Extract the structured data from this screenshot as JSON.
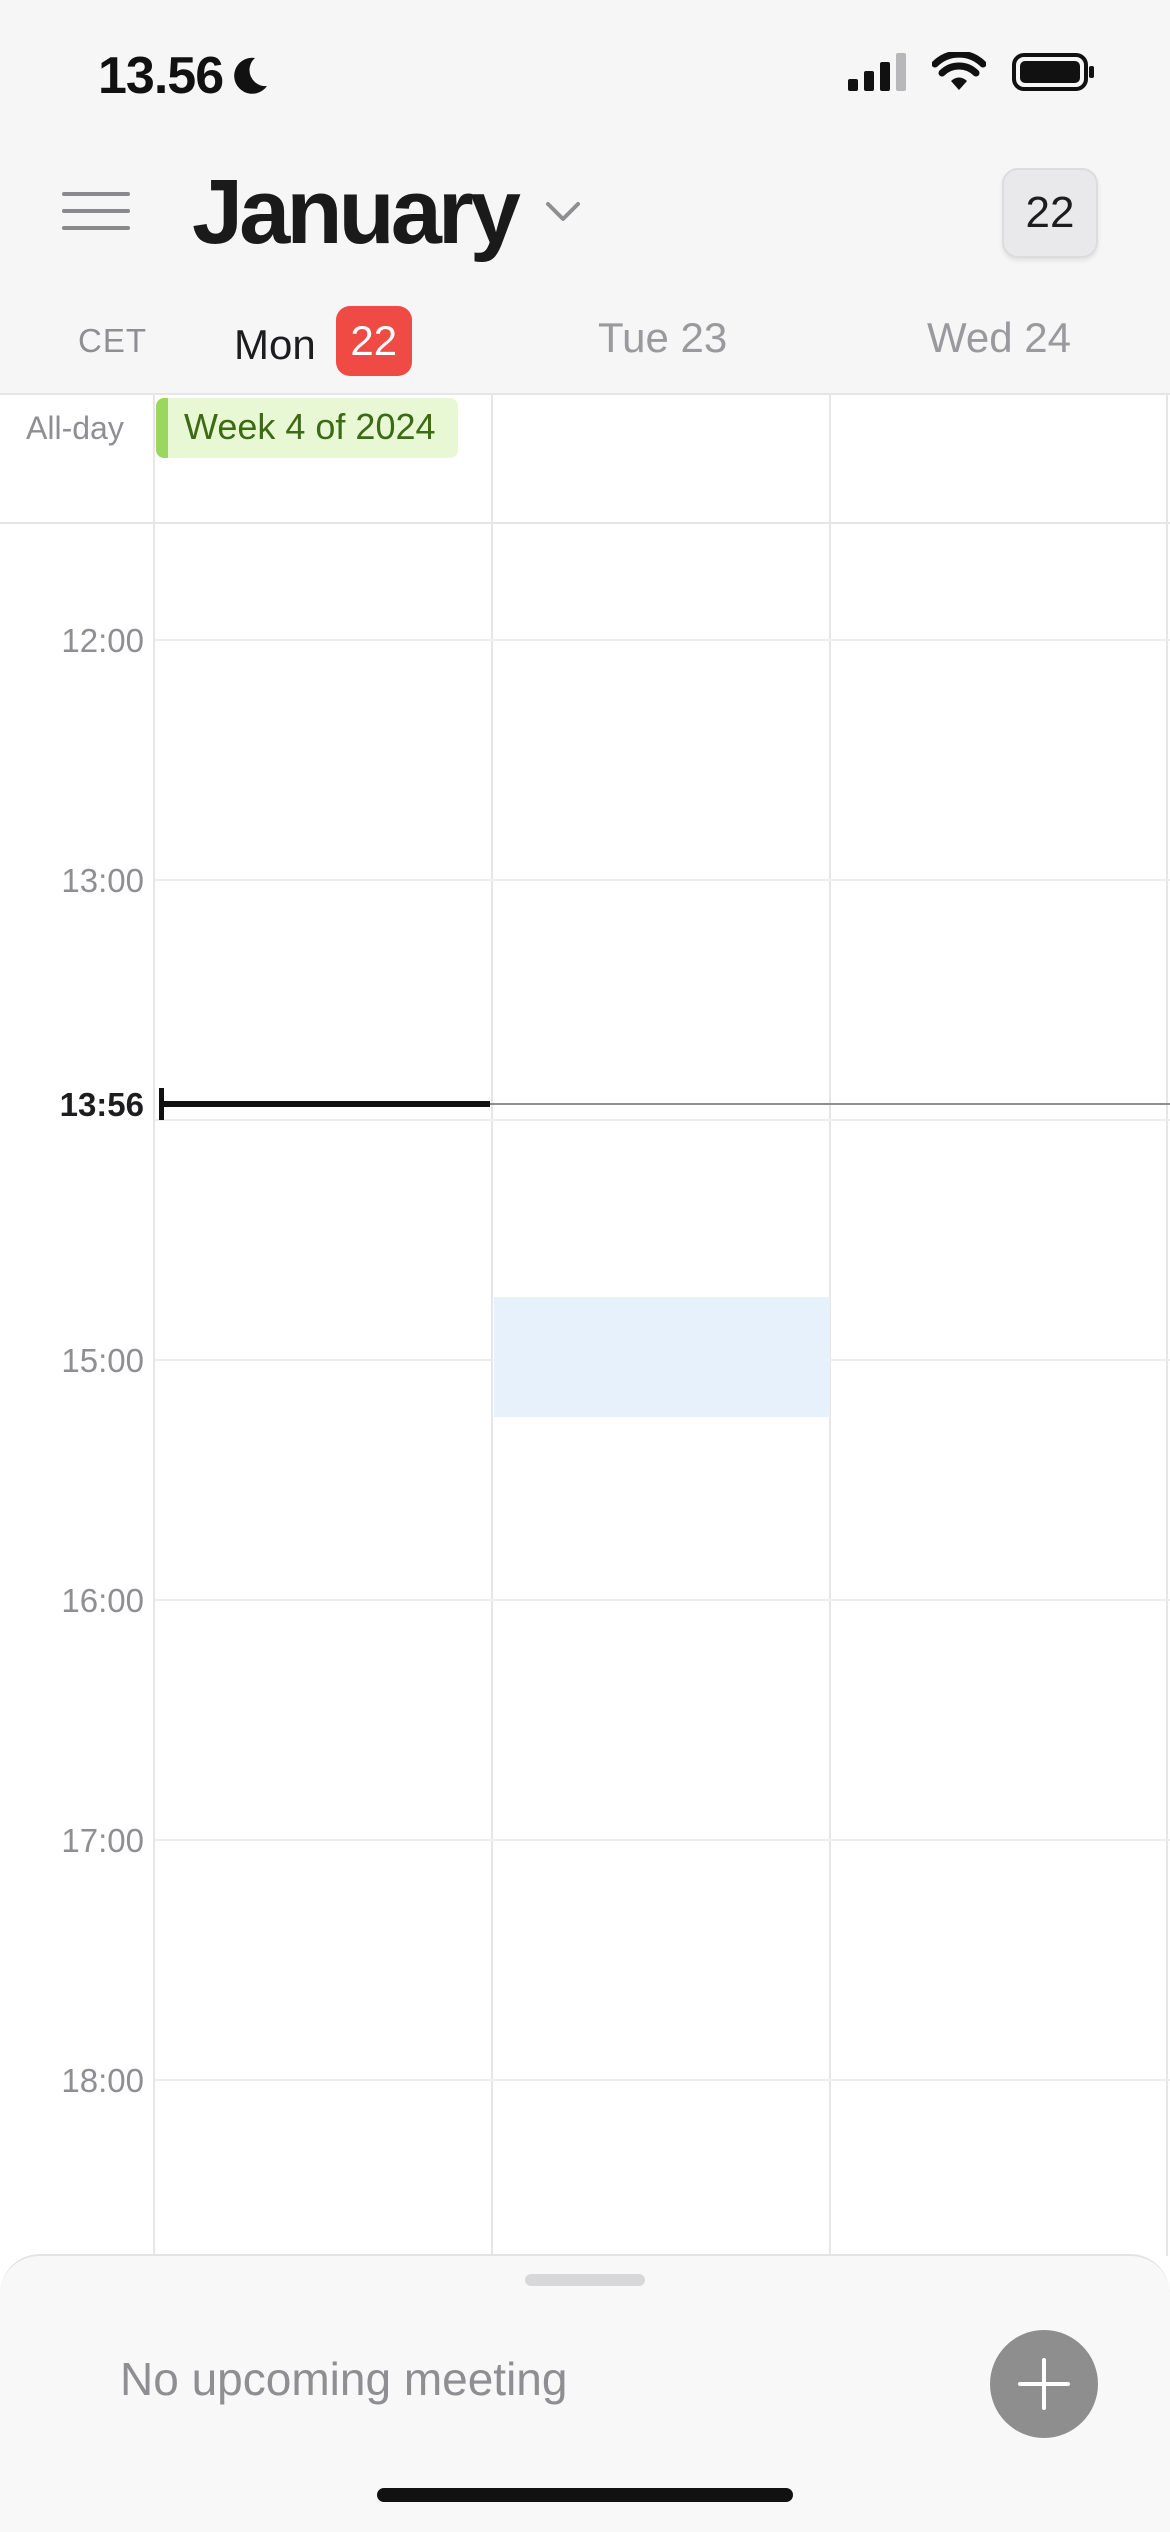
{
  "status_bar": {
    "time": "13.56",
    "focus_icon": "moon-icon",
    "signal_icon": "cellular-signal-icon",
    "wifi_icon": "wifi-icon",
    "battery_icon": "battery-icon"
  },
  "header": {
    "month": "January",
    "today_button": "22",
    "menu_icon": "hamburger-menu-icon",
    "dropdown_icon": "chevron-down-icon"
  },
  "days_row": {
    "timezone": "CET",
    "days": [
      {
        "weekday": "Mon",
        "date": "22",
        "today": true
      },
      {
        "label": "Tue 23"
      },
      {
        "label": "Wed 24"
      }
    ]
  },
  "all_day": {
    "label": "All-day",
    "event": "Week 4 of 2024",
    "event_color": "#9bd65e"
  },
  "time_grid": {
    "hours": [
      "12:00",
      "13:00",
      "15:00",
      "16:00",
      "17:00",
      "18:00"
    ],
    "current_time": "13:56"
  },
  "bottom_sheet": {
    "status": "No upcoming meeting",
    "add_icon": "plus-icon"
  },
  "colors": {
    "today_badge": "#f04a45",
    "selection_block": "#e6f1fb"
  }
}
